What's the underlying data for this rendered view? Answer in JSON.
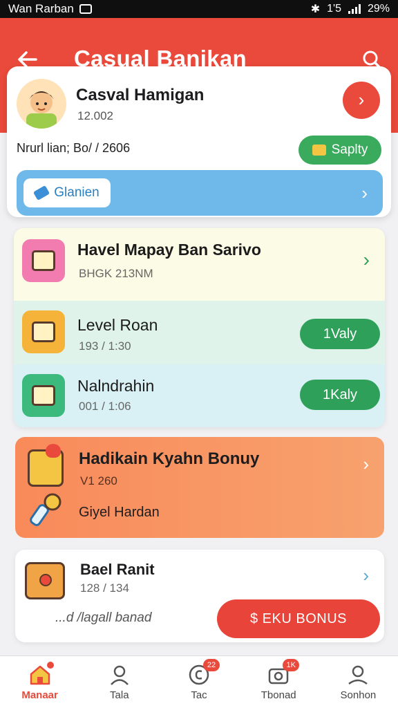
{
  "status_bar": {
    "carrier": "Wan Rarban",
    "time": "1'5",
    "battery": "29%"
  },
  "header": {
    "title": "Casual Banikan"
  },
  "profile": {
    "name": "Casval Hamigan",
    "id": "12.002",
    "detail": "Nrurl lian; Bo/ / 2606",
    "supply_label": "Saplty",
    "tag_label": "Glanien"
  },
  "quests": [
    {
      "title": "Havel  Mapay Ban Sarivo",
      "sub": "BHGK 213NM"
    },
    {
      "title": "Level Roan",
      "sub": "193 / 1:30",
      "action": "1Valy"
    },
    {
      "title": "Nalndrahin",
      "sub": "001 / 1:06",
      "action": "1Kaly"
    }
  ],
  "bonus": {
    "title": "Hadikain Kyahn Bonuy",
    "sub": "V1 260",
    "item_label": "Giyel Hardan"
  },
  "reward": {
    "title": "Bael Ranit",
    "sub": "128 / 134",
    "note": "...d /lagall banad",
    "button": "$ EKU BONUS"
  },
  "bottom_nav": [
    {
      "label": "Manaar",
      "icon": "home-icon",
      "active": true
    },
    {
      "label": "Tala",
      "icon": "user-icon",
      "badge": ""
    },
    {
      "label": "Tac",
      "icon": "coin-icon",
      "badge": "22"
    },
    {
      "label": "Tbonad",
      "icon": "camera-icon",
      "badge": "1K"
    },
    {
      "label": "Sonhon",
      "icon": "profile-icon"
    }
  ],
  "colors": {
    "primary": "#e94a3b",
    "green": "#2fa05a",
    "blue": "#6fb9ea",
    "orange": "#f98a5a"
  }
}
